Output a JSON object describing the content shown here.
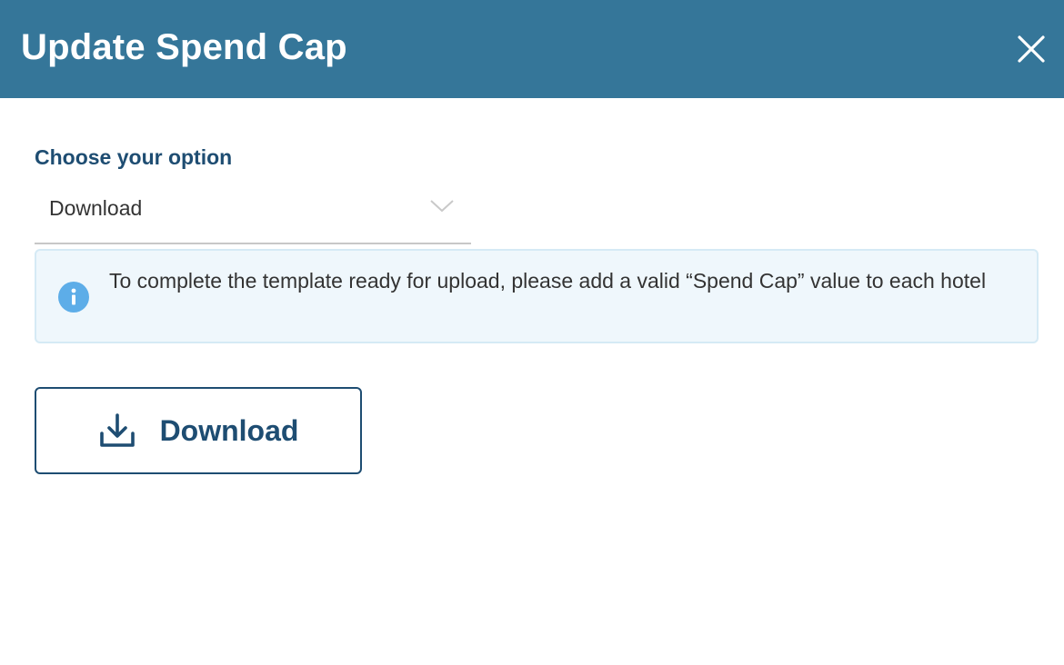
{
  "dialog": {
    "title": "Update Spend Cap",
    "close_icon": "close-icon",
    "header_color": "#357699"
  },
  "option_select": {
    "label": "Choose your option",
    "selected_value": "Download",
    "icon": "chevron-down-icon"
  },
  "info_notice": {
    "icon": "info-icon",
    "text": "To complete the template ready for upload, please add a valid “Spend Cap” value to each hotel"
  },
  "download_button": {
    "label": "Download",
    "icon": "download-icon",
    "color": "#1e4d72"
  }
}
